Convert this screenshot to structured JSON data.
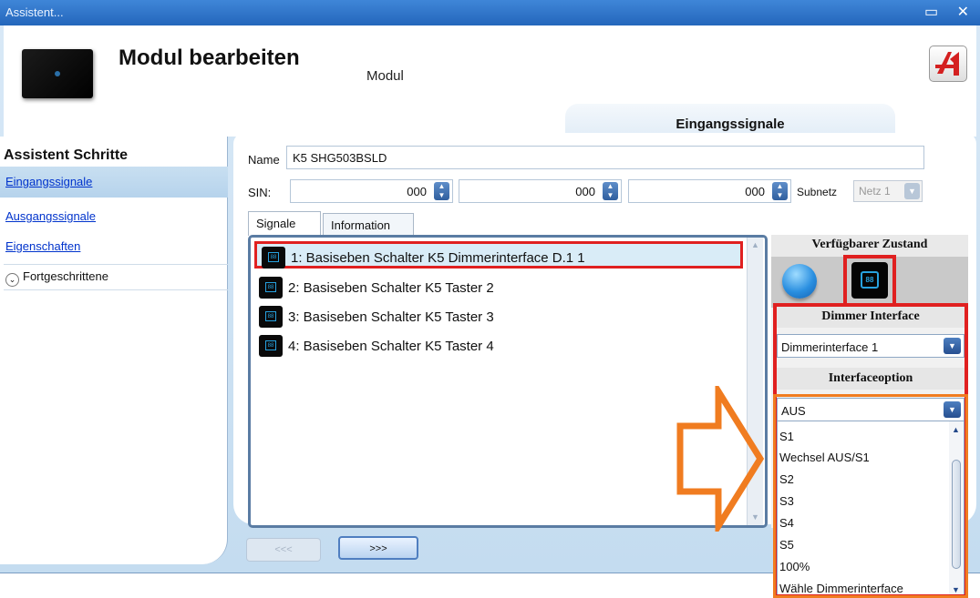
{
  "window": {
    "title": "Assistent...",
    "controls": "▭ ✕"
  },
  "header": {
    "title": "Modul bearbeiten",
    "subtitle": "Modul",
    "step_tab": "Eingangssignale"
  },
  "sidebar": {
    "title": "Assistent Schritte",
    "items": [
      {
        "label": "Eingangssignale",
        "active": true
      },
      {
        "label": "Ausgangssignale",
        "active": false
      },
      {
        "label": "Eigenschaften",
        "active": false
      }
    ],
    "advanced": "Fortgeschrittene"
  },
  "form": {
    "name_label": "Name",
    "name_value": "K5 SHG503BSLD",
    "sin_label": "SIN:",
    "sin_values": [
      "000",
      "000",
      "000"
    ],
    "subnet_label": "Subnetz",
    "subnet_value": "Netz 1"
  },
  "tabs": [
    {
      "label": "Signale",
      "selected": true
    },
    {
      "label": "Information",
      "selected": false
    }
  ],
  "signals": [
    {
      "label": "1: Basiseben Schalter K5 Dimmerinterface D.1 1",
      "selected": true
    },
    {
      "label": "2: Basiseben Schalter K5 Taster 2",
      "selected": false
    },
    {
      "label": "3: Basiseben Schalter K5 Taster 3",
      "selected": false
    },
    {
      "label": "4: Basiseben Schalter K5 Taster 4",
      "selected": false
    }
  ],
  "right": {
    "available_state": "Verfügbarer Zustand",
    "dimmer_interface_label": "Dimmer Interface",
    "dimmer_interface_value": "Dimmerinterface 1",
    "interface_option_label": "Interfaceoption",
    "interface_option_value": "AUS",
    "options": [
      "S1",
      "Wechsel AUS/S1",
      "S2",
      "S3",
      "S4",
      "S5",
      "100%",
      "Wähle Dimmerinterface"
    ]
  },
  "icon_text": "88",
  "logo_mark": "⮋",
  "nav": {
    "prev": "<<<",
    "next": ">>>"
  },
  "colors": {
    "highlight_red": "#e02020",
    "arrow_orange": "#f07c20",
    "title_blue": "#2466bb"
  }
}
